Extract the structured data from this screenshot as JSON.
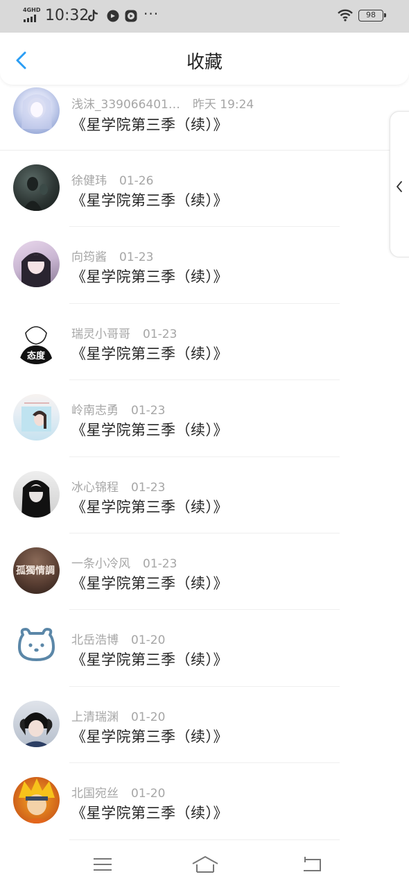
{
  "status_bar": {
    "network": "4GHD",
    "time": "10:32",
    "dots": "···",
    "battery": "98"
  },
  "header": {
    "title": "收藏"
  },
  "items": [
    {
      "user": "浅沫_339066401…",
      "date": "昨天 19:24",
      "title": "《星学院第三季（续）》"
    },
    {
      "user": "徐健玮",
      "date": "01-26",
      "title": "《星学院第三季（续）》"
    },
    {
      "user": "向筠酱",
      "date": "01-23",
      "title": "《星学院第三季（续）》"
    },
    {
      "user": "瑞灵小哥哥",
      "date": "01-23",
      "title": "《星学院第三季（续）》"
    },
    {
      "user": "岭南志勇",
      "date": "01-23",
      "title": "《星学院第三季（续）》"
    },
    {
      "user": "冰心锦程",
      "date": "01-23",
      "title": "《星学院第三季（续）》"
    },
    {
      "user": "一条小冷风",
      "date": "01-23",
      "title": "《星学院第三季（续）》"
    },
    {
      "user": "北岳浩博",
      "date": "01-20",
      "title": "《星学院第三季（续）》"
    },
    {
      "user": "上清瑞渊",
      "date": "01-20",
      "title": "《星学院第三季（续）》"
    },
    {
      "user": "北国宛丝",
      "date": "01-20",
      "title": "《星学院第三季（续）》"
    }
  ],
  "avatar_text": {
    "item4": "态度",
    "item7": "孤獨情調"
  },
  "colors": {
    "accent": "#2a9df4",
    "meta_text": "#a6a6a6",
    "title_text": "#262626"
  },
  "icons": {
    "back": "chevron-left-icon",
    "drawer": "chevron-left-icon",
    "nav": [
      "menu-icon",
      "home-icon",
      "back-icon"
    ]
  }
}
